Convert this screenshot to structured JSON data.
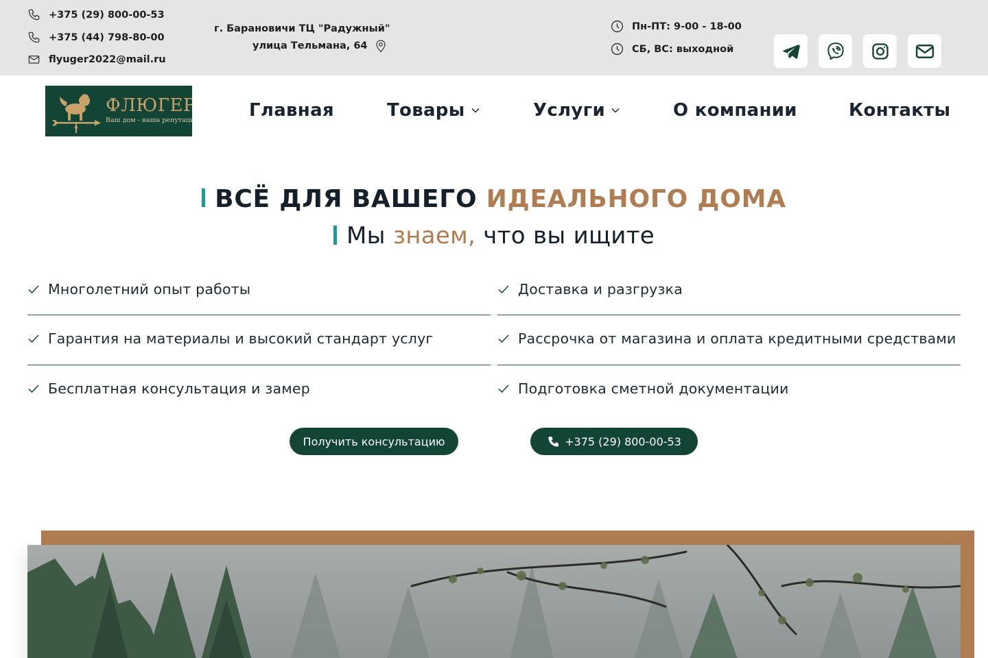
{
  "topbar": {
    "phone1": "+375 (29) 800-00-53",
    "phone2": "+375 (44) 798-80-00",
    "email": "flyuger2022@mail.ru",
    "address_line1": "г. Барановичи ТЦ \"Радужный\"",
    "address_line2": "улица Тельмана, 64",
    "hours_weekdays": "Пн-ПТ: 9-00 - 18-00",
    "hours_weekend": "СБ, ВС: выходной",
    "social": [
      "telegram-icon",
      "viber-icon",
      "instagram-icon",
      "mail-icon"
    ]
  },
  "logo": {
    "name": "ФЛЮГЕР",
    "tagline": "Ваш дом - наша репутация"
  },
  "nav": {
    "home": "Главная",
    "goods": "Товары",
    "services": "Услуги",
    "about": "О компании",
    "contacts": "Контакты"
  },
  "hero": {
    "title_part1": "ВСЁ ДЛЯ ВАШЕГО",
    "title_part2": "ИДЕАЛЬНОГО ДОМА",
    "subtitle_part1": "Мы",
    "subtitle_part2": "знаем,",
    "subtitle_part3": "что вы ищите",
    "features": [
      "Многолетний опыт работы",
      "Доставка и разгрузка",
      "Гарантия на материалы и высокий стандарт услуг",
      "Рассрочка от магазина и оплата кредитными средствами",
      "Бесплатная консультация и замер",
      "Подготовка сметной документации"
    ],
    "consult_button": "Получить консультацию",
    "phone_button": "+375 (29) 800-00-53"
  },
  "colors": {
    "brand_green": "#134537",
    "accent_brown": "#b07d52",
    "teal_bar": "#1c9a93",
    "topbar_bg": "#e5e5e5"
  }
}
